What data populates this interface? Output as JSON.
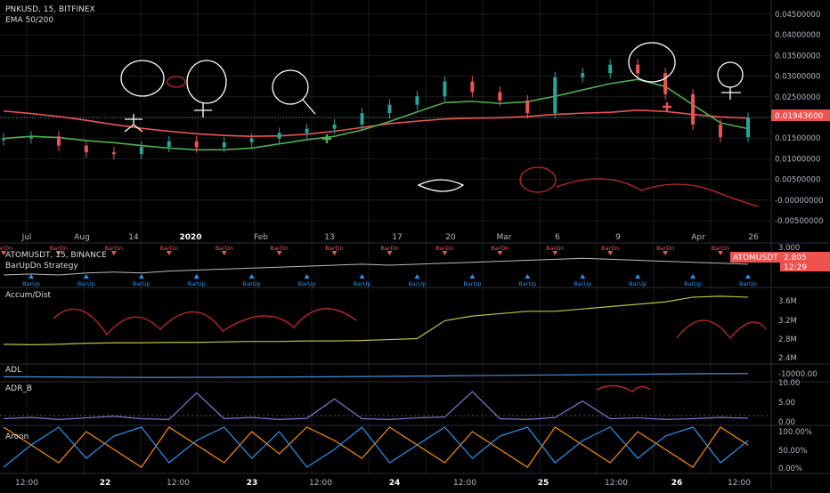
{
  "colors": {
    "background": "#000000",
    "grid": "#1a1a1a",
    "candle_up": "#26a69a",
    "candle_down": "#ef5350",
    "ema50": "#4caf50",
    "ema200": "#ef5350",
    "price_line": "#26a69a",
    "price_badge": "#ef5350",
    "accum": "#c0c040",
    "adl": "#4a90d9",
    "adr": "#8a6fd1",
    "aroon_up": "#ff8c00",
    "aroon_down": "#2196f3",
    "drawing": "#ffffff",
    "drawing_red": "#c62828",
    "axis_text": "#b2b5be"
  },
  "chart_data": [
    {
      "type": "line",
      "panel": "main",
      "symbol_title": "PNKUSD, 15, BITFINEX",
      "indicator_title": "EMA 50/200",
      "x_tick_labels": [
        "Jul",
        "Aug",
        "14",
        "2020",
        "Feb",
        "13",
        "17",
        "20",
        "Mar",
        "6",
        "9",
        "Apr",
        "26"
      ],
      "y_tick_labels": [
        "0.04500000",
        "0.04000000",
        "0.03500000",
        "0.03000000",
        "0.02500000",
        "0.02000000",
        "0.01500000",
        "0.01000000",
        "0.00500000",
        "-0.00000000",
        "-0.00500000"
      ],
      "ylim": [
        -0.0065,
        0.0465
      ],
      "last_price_label": "0.01943600",
      "last_price": 0.019436,
      "series": [
        {
          "key": "ema200",
          "values": [
            0.021,
            0.0204,
            0.0197,
            0.0188,
            0.0178,
            0.0169,
            0.0162,
            0.0156,
            0.0152,
            0.015,
            0.0151,
            0.0155,
            0.0162,
            0.0171,
            0.018,
            0.0186,
            0.0191,
            0.0193,
            0.0194,
            0.0197,
            0.0202,
            0.0205,
            0.0207,
            0.0212,
            0.0209,
            0.0202,
            0.0196,
            0.0193
          ]
        },
        {
          "key": "ema50",
          "values": [
            0.0145,
            0.015,
            0.0147,
            0.014,
            0.0135,
            0.0128,
            0.0122,
            0.0118,
            0.0118,
            0.0122,
            0.0132,
            0.0142,
            0.015,
            0.0165,
            0.0185,
            0.0208,
            0.023,
            0.0233,
            0.0228,
            0.0232,
            0.0245,
            0.026,
            0.0275,
            0.0285,
            0.0268,
            0.0225,
            0.0182,
            0.0168
          ]
        },
        {
          "key": "price",
          "values": [
            0.0145,
            0.015,
            0.0128,
            0.0112,
            0.0108,
            0.0125,
            0.0138,
            0.0124,
            0.0136,
            0.0145,
            0.0158,
            0.0168,
            0.0178,
            0.0205,
            0.0225,
            0.0245,
            0.028,
            0.0255,
            0.0235,
            0.0205,
            0.029,
            0.03,
            0.032,
            0.03,
            0.025,
            0.0178,
            0.0148,
            0.0194
          ]
        }
      ]
    },
    {
      "type": "line",
      "panel": "atom",
      "symbol_title": "ATOMUSDT, 15, BINANCE",
      "indicator_title": "BarUpDn Strategy",
      "y_tick_labels": [
        "3.000"
      ],
      "badge_label": "ATOMUSDT",
      "badge_value": "2.805",
      "timer": "12:29",
      "signal_down_label": "BarDn",
      "signal_up_label": "BarUp",
      "series": [
        {
          "key": "price",
          "values": [
            2.7,
            2.71,
            2.7,
            2.72,
            2.73,
            2.72,
            2.74,
            2.75,
            2.76,
            2.77,
            2.78,
            2.79,
            2.8,
            2.81,
            2.8,
            2.81,
            2.82,
            2.83,
            2.84,
            2.85,
            2.86,
            2.87,
            2.86,
            2.85,
            2.84,
            2.83,
            2.82,
            2.81
          ]
        }
      ]
    },
    {
      "type": "line",
      "panel": "accum",
      "title": "Accum/Dist",
      "y_tick_labels": [
        "3.6M",
        "3.2M",
        "2.8M",
        "2.4M"
      ],
      "ylim": [
        2.3,
        3.85
      ],
      "series": [
        {
          "key": "accum",
          "values": [
            2.7,
            2.69,
            2.7,
            2.72,
            2.73,
            2.73,
            2.74,
            2.74,
            2.75,
            2.76,
            2.76,
            2.77,
            2.77,
            2.78,
            2.8,
            2.82,
            3.2,
            3.3,
            3.35,
            3.4,
            3.4,
            3.45,
            3.5,
            3.55,
            3.6,
            3.7,
            3.72,
            3.7
          ]
        }
      ]
    },
    {
      "type": "line",
      "panel": "adl",
      "title": "ADL",
      "y_tick_labels": [
        "-10000.00"
      ],
      "ylim": [
        -12000,
        -5000
      ],
      "series": [
        {
          "key": "adl",
          "values": [
            -10200,
            -10250,
            -10300,
            -10400,
            -10450,
            -10500,
            -10480,
            -10450,
            -10400,
            -10350,
            -10300,
            -10250,
            -10200,
            -10100,
            -10000,
            -9900,
            -9800,
            -9700,
            -9600,
            -9500,
            -9400,
            -9300,
            -9200,
            -9100,
            -9000,
            -8900,
            -8850,
            -8800
          ]
        }
      ]
    },
    {
      "type": "line",
      "panel": "adr",
      "title": "ADR_B",
      "y_tick_labels": [
        "10.00",
        "5.00",
        "0.00"
      ],
      "ylim": [
        0,
        10
      ],
      "series": [
        {
          "key": "adr",
          "values": [
            1.2,
            1.5,
            1.0,
            1.4,
            1.8,
            1.2,
            1.0,
            7.5,
            1.2,
            1.5,
            1.0,
            1.3,
            6.0,
            1.2,
            1.0,
            1.4,
            1.6,
            7.8,
            1.2,
            1.0,
            1.5,
            5.5,
            1.2,
            1.4,
            1.0,
            1.2,
            1.5,
            1.3
          ]
        }
      ]
    },
    {
      "type": "line",
      "panel": "aroon",
      "title": "Aroon",
      "y_tick_labels": [
        "100.00%",
        "50.00%",
        "0.00%"
      ],
      "ylim": [
        0,
        100
      ],
      "series": [
        {
          "key": "aroon_up",
          "values": [
            100,
            60,
            20,
            90,
            50,
            10,
            100,
            60,
            20,
            90,
            40,
            100,
            70,
            30,
            100,
            60,
            20,
            90,
            50,
            10,
            100,
            60,
            20,
            90,
            50,
            10,
            100,
            60
          ]
        },
        {
          "key": "aroon_down",
          "values": [
            10,
            60,
            100,
            30,
            80,
            100,
            20,
            70,
            100,
            30,
            90,
            10,
            50,
            100,
            20,
            60,
            100,
            30,
            80,
            100,
            20,
            70,
            100,
            30,
            80,
            100,
            20,
            70
          ]
        }
      ],
      "x_tick_labels": [
        "12:00",
        "22",
        "12:00",
        "23",
        "12:00",
        "24",
        "12:00",
        "25",
        "12:00",
        "26",
        "12:00"
      ]
    }
  ]
}
